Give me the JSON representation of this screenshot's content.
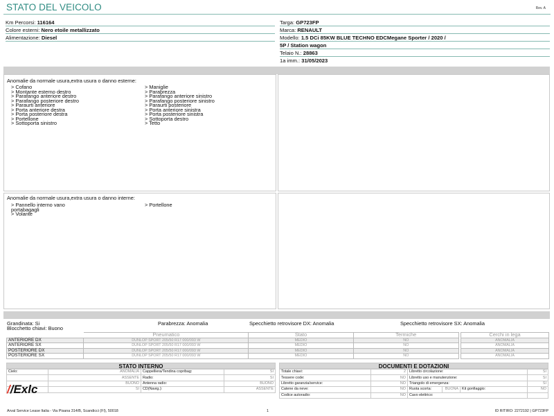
{
  "header": {
    "title": "STATO DEL VEICOLO",
    "revision": "Rev. A"
  },
  "vehicle_left": [
    {
      "label": "Km Percorsi: ",
      "value": "116164"
    },
    {
      "label": "Colore esterni: ",
      "value": "Nero etoile metallizzato"
    },
    {
      "label": "Alimentazione: ",
      "value": "Diesel"
    }
  ],
  "vehicle_right": [
    {
      "label": "Targa: ",
      "value": "GP723FP"
    },
    {
      "label": "Marca: ",
      "value": "RENAULT"
    },
    {
      "label": "Modello: ",
      "value": "1.5 DCi 85KW BLUE TECHNO EDCMegane Sporter / 2020 /"
    },
    {
      "label": "",
      "value": "5P / Station wagon"
    },
    {
      "label": "Telaio N.: ",
      "value": "28863"
    },
    {
      "label": "1a imm.: ",
      "value": "31/05/2023"
    }
  ],
  "external_damage": {
    "title": "Anomalie da normale usura,extra usura o danno esterne:",
    "col1": [
      "> Cofano",
      "> Montante esterno destro",
      "> Parafango anteriore destro",
      "> Parafango posteriore destro",
      "> Paraurti anteriore",
      "> Porta anteriore destra",
      "> Porta posteriore destra",
      "> Portellone",
      "> Sottoporta sinistro"
    ],
    "col2": [
      "> Maniglie",
      "> Parabrezza",
      "> Parafango anteriore sinistro",
      "> Parafango posteriore sinistro",
      "> Paraurti posteriore",
      "> Porta anteriore sinistra",
      "> Porta posteriore sinistra",
      "> Sottoporta destro",
      "> Tetto"
    ]
  },
  "internal_damage": {
    "title": "Anomalie da normale usura,extra usura o danno interne:",
    "col1": [
      "> Pannello interno vano",
      "portabagagli",
      "> Volante"
    ],
    "col2": [
      "> Portellone"
    ]
  },
  "checks": {
    "grandinata": "Grandinata: Si",
    "blocchetto": "Blocchetto chiavi: Buono",
    "parabrezza": "Parabrezza: Anomalia",
    "specchietto_dx": "Specchietto retrovisore DX: Anomalia",
    "specchietto_sx": "Specchietto retrovisore SX: Anomalia"
  },
  "tyres": {
    "headers": {
      "pneumatico": "Pneumatico",
      "stato": "Stato",
      "termiche": "Termiche",
      "cerchi": "Cerchi in lega"
    },
    "rows": [
      {
        "position": "ANTERIORE DX",
        "tyre": "DUNLOP SPORT 205/50 R17 000/093 W",
        "stato": "MEDIO",
        "termiche": "NO",
        "cerchi": "ANOMALIA"
      },
      {
        "position": "ANTERIORE SX",
        "tyre": "DUNLOP SPORT 205/50 R17 000/093 W",
        "stato": "MEDIO",
        "termiche": "NO",
        "cerchi": "ANOMALIA"
      },
      {
        "position": "POSTERIORE DX",
        "tyre": "DUNLOP SPORT 205/50 R17 000/093 W",
        "stato": "MEDIO",
        "termiche": "NO",
        "cerchi": "ANOMALIA"
      },
      {
        "position": "POSTERIORE SX",
        "tyre": "DUNLOP SPORT 205/50 R17 000/093 W",
        "stato": "MEDIO",
        "termiche": "NO",
        "cerchi": "ANOMALIA"
      }
    ]
  },
  "stato_interno": {
    "title": "STATO INTERNO",
    "rows": [
      [
        {
          "label": "Cielo:",
          "value": "ANOMALIA"
        },
        {
          "label": "Cappelliera/Tendina copribag:",
          "value": "SI"
        }
      ],
      [
        {
          "label": "",
          "value": "ASSENTE"
        },
        {
          "label": "Radio:",
          "value": "SI"
        }
      ],
      [
        {
          "label": "",
          "value": "BUONO"
        },
        {
          "label": "Antenna radio:",
          "value": "BUONO"
        }
      ],
      [
        {
          "label": "",
          "value": "SI"
        },
        {
          "label": "CD(Navig.):",
          "value": "ASSENTE"
        }
      ]
    ]
  },
  "documenti": {
    "title": "DOCUMENTI E DOTAZIONI",
    "rows": [
      [
        {
          "label": "Totale chiavi:",
          "value": "2"
        },
        {
          "label": "Libretto circolazione:",
          "value": "SI"
        }
      ],
      [
        {
          "label": "Tessere code:",
          "value": "NO"
        },
        {
          "label": "Libretto uso e manutenzione:",
          "value": "SI"
        }
      ],
      [
        {
          "label": "Libretto garanzia/service:",
          "value": "NO"
        },
        {
          "label": "Triangolo di emergenza:",
          "value": "SI"
        }
      ],
      [
        {
          "label": "Catene da neve:",
          "value": "NO"
        },
        {
          "label": "Ruota scorta:",
          "value": "BUONA"
        },
        {
          "label": "Kit gonfiaggio:",
          "value": "NO"
        }
      ],
      [
        {
          "label": "Codice autoradio:",
          "value": "NO"
        },
        {
          "label": "Cavo elettrico:",
          "value": ""
        }
      ]
    ]
  },
  "logo": {
    "text": "Exlc"
  },
  "footer": {
    "company": "Arval Service Lease Italia - Via Pisana 314/B, Scandicci (FI), 50018",
    "page": "1",
    "id": "ID RITIRO: 2272192 | GP723FP"
  }
}
